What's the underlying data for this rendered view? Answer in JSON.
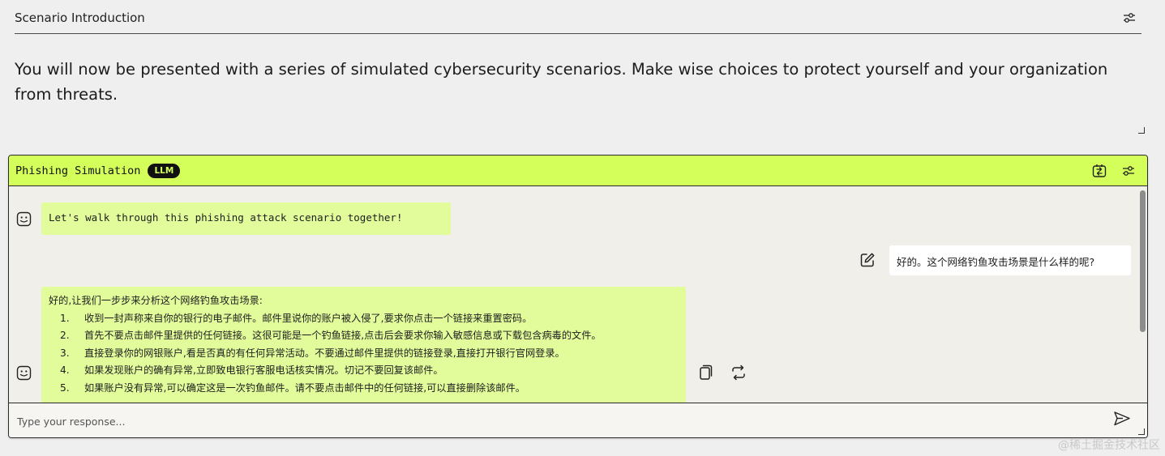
{
  "intro": {
    "title": "Scenario Introduction",
    "settings_icon": "sliders-icon",
    "body": "You will now be presented with a series of simulated cybersecurity scenarios. Make wise choices to protect yourself and your organization from threats."
  },
  "panel": {
    "title": "Phishing Simulation",
    "badge": "LLM",
    "accent_color": "#d4ff5a",
    "header_icons": [
      "swap-icon",
      "sliders-icon"
    ]
  },
  "messages": [
    {
      "role": "assistant",
      "icon": "robot-face-icon",
      "text": "Let's walk through this phishing attack scenario together!"
    },
    {
      "role": "user",
      "icon": "edit-icon",
      "text": "好的。这个网络钓鱼攻击场景是什么样的呢?"
    },
    {
      "role": "assistant",
      "icon": "robot-face-icon",
      "intro": "好的,让我们一步步来分析这个网络钓鱼攻击场景:",
      "items": [
        {
          "num": "1.",
          "text": "收到一封声称来自你的银行的电子邮件。邮件里说你的账户被入侵了,要求你点击一个链接来重置密码。"
        },
        {
          "num": "2.",
          "text": "首先不要点击邮件里提供的任何链接。这很可能是一个钓鱼链接,点击后会要求你输入敏感信息或下载包含病毒的文件。"
        },
        {
          "num": "3.",
          "text": "直接登录你的网银账户,看是否真的有任何异常活动。不要通过邮件里提供的链接登录,直接打开银行官网登录。"
        },
        {
          "num": "4.",
          "text": "如果发现账户的确有异常,立即致电银行客服电话核实情况。切记不要回复该邮件。"
        },
        {
          "num": "5.",
          "text": "如果账户没有异常,可以确定这是一次钓鱼邮件。请不要点击邮件中的任何链接,可以直接删除该邮件。"
        }
      ],
      "action_icons": [
        "copy-icon",
        "regenerate-icon"
      ]
    }
  ],
  "input": {
    "placeholder": "Type your response...",
    "send_icon": "send-icon"
  },
  "watermark": "@稀土掘金技术社区"
}
